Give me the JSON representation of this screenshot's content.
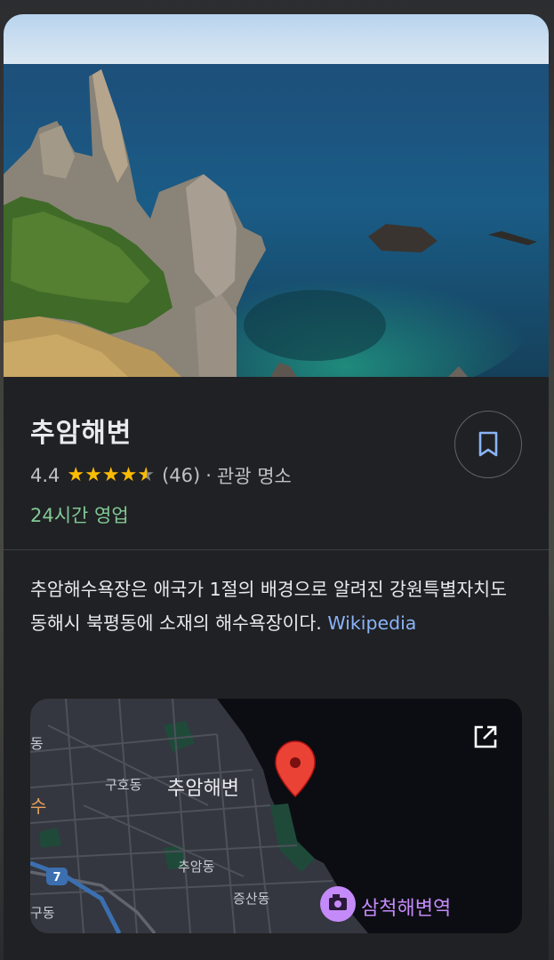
{
  "place": {
    "title": "추암해변",
    "rating": "4.4",
    "stars": 4.5,
    "review_count": "(46)",
    "separator": "·",
    "category": "관광 명소",
    "hours": "24시간 영업"
  },
  "description": {
    "text": "추암해수욕장은 애국가 1절의 배경으로 알려진 강원특별자치도 동해시 북평동에 소재의 해수욕장이다.",
    "source": "Wikipedia"
  },
  "map": {
    "labels": {
      "dong_left": "동",
      "guho": "구호동",
      "place": "추암해변",
      "suffix_left": "수",
      "chuam": "추암동",
      "jeungsan": "증산동",
      "gudong": "구동",
      "route": "7",
      "station": "삼척해변역"
    }
  },
  "colors": {
    "card_bg": "#202124",
    "rating_star": "#fbbc04",
    "open_green": "#81c995",
    "link_blue": "#8ab4f8",
    "pin_red": "#ea4335",
    "station_purple": "#c58af9"
  },
  "icons": {
    "save": "bookmark-icon",
    "open_external": "open-in-new-icon",
    "pin": "map-pin-icon",
    "station": "camera-plus-icon"
  }
}
